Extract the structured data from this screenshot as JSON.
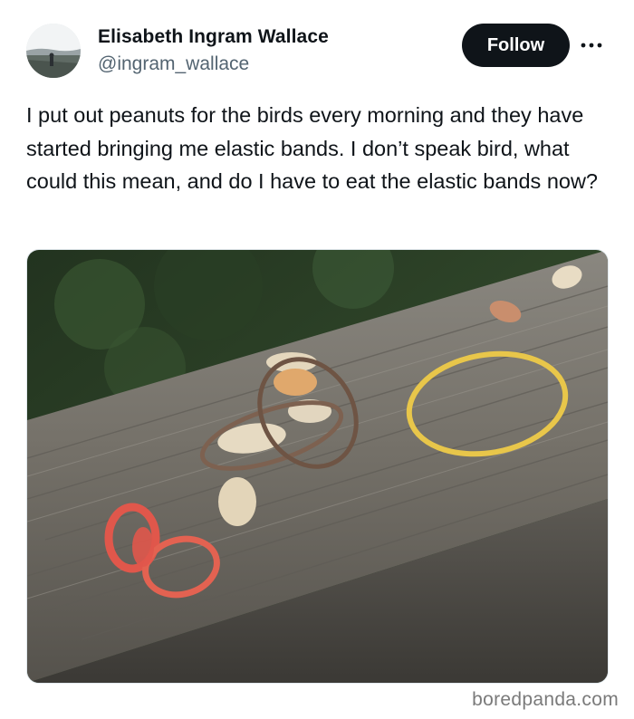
{
  "tweet": {
    "author_name": "Elisabeth Ingram Wallace",
    "author_handle": "@ingram_wallace",
    "follow_label": "Follow",
    "text": "I put out peanuts for the birds every morning and they have started bringing me elastic bands. I don’t speak bird, what could this mean, and do I have to eat the elastic bands now?"
  },
  "icons": {
    "more": "more-options-icon",
    "avatar": "profile-avatar"
  },
  "colors": {
    "follow_bg": "#0f1419",
    "handle": "#536471",
    "band_yellow": "#e8c64a",
    "band_red": "#e0574b",
    "band_brown": "#7d6150"
  },
  "watermark": {
    "text": "boredpanda.com"
  }
}
